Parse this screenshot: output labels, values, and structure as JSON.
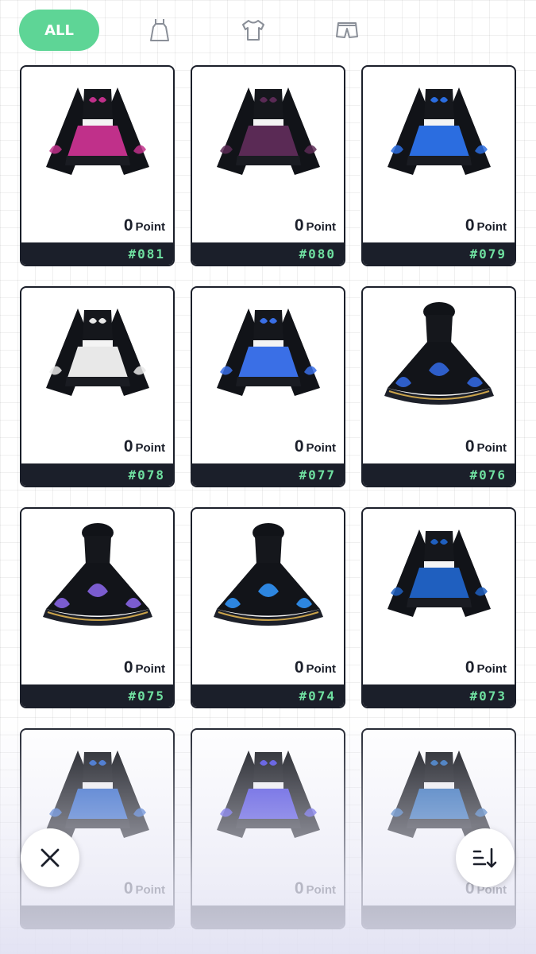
{
  "tabs": {
    "all_label": "ALL",
    "icons": [
      "dress-icon",
      "shirt-icon",
      "shorts-icon"
    ]
  },
  "colors": {
    "accent": "#5ed596",
    "card_border": "#1b1f2a",
    "footer_bg": "#1b1f2a",
    "code_text": "#6fe0a0"
  },
  "items": [
    {
      "code": "#081",
      "points": "0",
      "unit": "Point",
      "style": "sleeved",
      "accent": "#c0308a",
      "image": "black-outfit-pink-skirt-white-butterflies"
    },
    {
      "code": "#080",
      "points": "0",
      "unit": "Point",
      "style": "sleeved",
      "accent": "#5a2a55",
      "image": "black-outfit-purple-skirt-white-butterflies"
    },
    {
      "code": "#079",
      "points": "0",
      "unit": "Point",
      "style": "sleeved",
      "accent": "#2b6de0",
      "image": "black-outfit-blue-butterflies"
    },
    {
      "code": "#078",
      "points": "0",
      "unit": "Point",
      "style": "sleeved",
      "accent": "#e8e8e8",
      "image": "black-outfit-white-lace"
    },
    {
      "code": "#077",
      "points": "0",
      "unit": "Point",
      "style": "sleeved",
      "accent": "#3a6fe6",
      "image": "black-outfit-blue-butterflies"
    },
    {
      "code": "#076",
      "points": "0",
      "unit": "Point",
      "style": "dress",
      "accent": "#2e5ec9",
      "image": "black-gold-dress-blue-butterflies"
    },
    {
      "code": "#075",
      "points": "0",
      "unit": "Point",
      "style": "dress",
      "accent": "#7b5ccf",
      "image": "black-ruffle-dress-purple-butterfly"
    },
    {
      "code": "#074",
      "points": "0",
      "unit": "Point",
      "style": "dress",
      "accent": "#2d86e0",
      "image": "black-gold-dress-blue-butterflies"
    },
    {
      "code": "#073",
      "points": "0",
      "unit": "Point",
      "style": "sleeved",
      "accent": "#1f5fbf",
      "image": "navy-outfit-blue-butterflies"
    },
    {
      "code": "",
      "points": "0",
      "unit": "Point",
      "style": "sleeved",
      "accent": "#2a63c8",
      "image": "navy-outfit-blue-butterflies"
    },
    {
      "code": "",
      "points": "0",
      "unit": "Point",
      "style": "sleeved",
      "accent": "#4a45e0",
      "image": "black-outfit-violet-butterflies"
    },
    {
      "code": "",
      "points": "0",
      "unit": "Point",
      "style": "sleeved",
      "accent": "#2b6bb8",
      "image": "navy-outfit-blue-butterflies"
    }
  ],
  "buttons": {
    "close_icon": "close-icon",
    "sort_icon": "sort-icon"
  }
}
